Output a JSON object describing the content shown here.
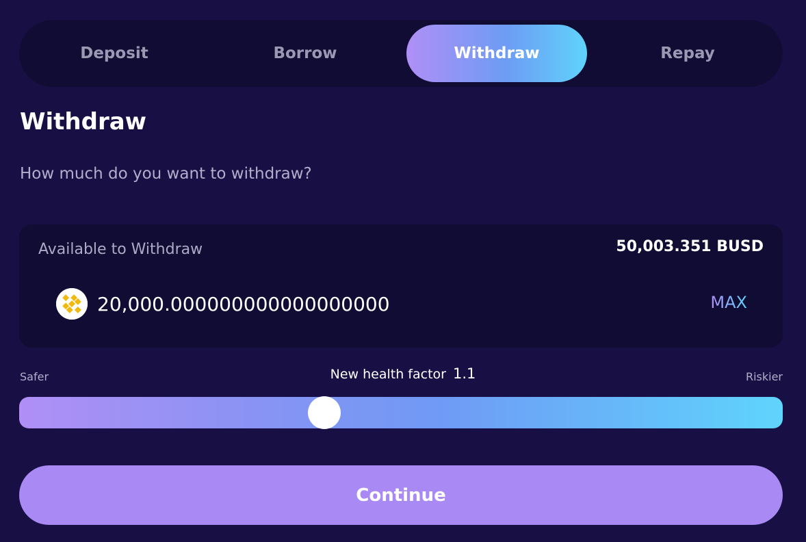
{
  "tabs": [
    {
      "label": "Deposit",
      "active": false
    },
    {
      "label": "Borrow",
      "active": false
    },
    {
      "label": "Withdraw",
      "active": true
    },
    {
      "label": "Repay",
      "active": false
    }
  ],
  "section": {
    "title": "Withdraw",
    "question": "How much do you want to withdraw?"
  },
  "amount": {
    "available_label": "Available to Withdraw",
    "available_value": "50,003.351 BUSD",
    "input_value": "20,000.000000000000000000",
    "token_icon": "busd-icon",
    "max_label": "MAX"
  },
  "health": {
    "safer_label": "Safer",
    "riskier_label": "Riskier",
    "label": "New health factor",
    "value": "1.1",
    "slider_fraction": 0.4
  },
  "actions": {
    "continue_label": "Continue"
  },
  "colors": {
    "background": "#181045",
    "panel": "#110c34",
    "accent_start": "#b08ff6",
    "accent_mid": "#6d9cf4",
    "accent_end": "#5fd3fb",
    "button": "#a98af5",
    "token_yellow": "#f0b90b"
  }
}
